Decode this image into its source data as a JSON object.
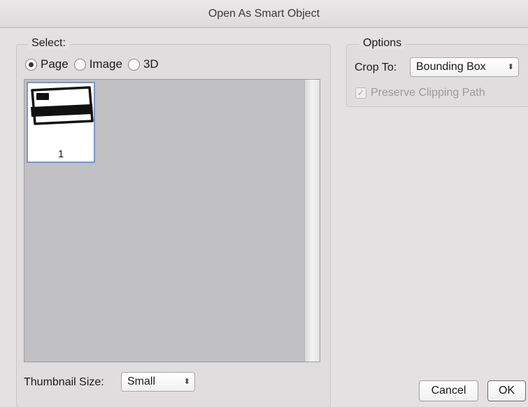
{
  "window": {
    "title": "Open As Smart Object"
  },
  "select_group": {
    "label": "Select:",
    "radios": [
      {
        "label": "Page",
        "checked": true
      },
      {
        "label": "Image",
        "checked": false
      },
      {
        "label": "3D",
        "checked": false
      }
    ],
    "thumbnails": [
      {
        "number": "1",
        "selected": true
      }
    ]
  },
  "thumbnail_size": {
    "label": "Thumbnail Size:",
    "value": "Small"
  },
  "options_group": {
    "label": "Options",
    "crop_to_label": "Crop To:",
    "crop_to_value": "Bounding Box",
    "preserve_clipping_path": {
      "label": "Preserve Clipping Path",
      "checked": true,
      "disabled": true
    }
  },
  "buttons": {
    "cancel": "Cancel",
    "ok": "OK"
  },
  "icons": {
    "popup_arrows": "updown-arrows-icon",
    "checkmark": "checkmark-icon"
  },
  "colors": {
    "selection_border": "#7d94c9",
    "list_background": "#c0bfc1"
  }
}
